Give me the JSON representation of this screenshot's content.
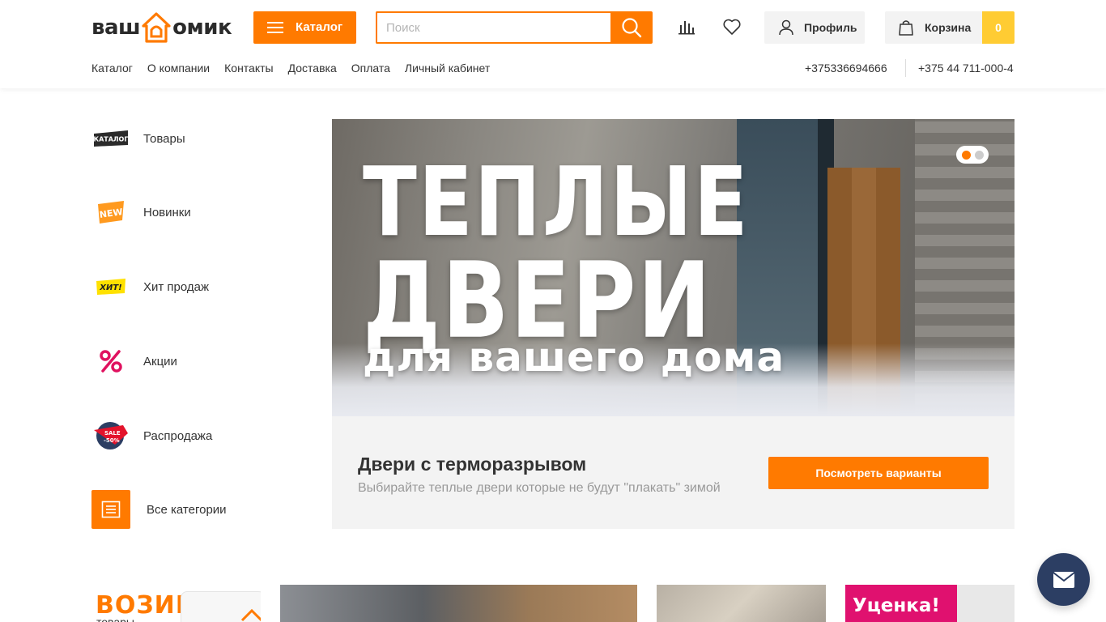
{
  "header": {
    "logo_text_left": "ваш",
    "logo_text_right": "омик",
    "catalog_label": "Каталог",
    "search": {
      "placeholder": "Поиск",
      "value": ""
    },
    "profile_label": "Профиль",
    "cart_label": "Корзина",
    "cart_count": "0"
  },
  "nav": {
    "items": [
      "Каталог",
      "О компании",
      "Контакты",
      "Доставка",
      "Оплата",
      "Личный кабинет"
    ]
  },
  "phones": [
    "+375336694666",
    "+375 44 711-000-4"
  ],
  "side_categories": [
    {
      "label": "Товары",
      "icon": "catalog-badge-icon"
    },
    {
      "label": "Новинки",
      "icon": "new-badge-icon"
    },
    {
      "label": "Хит продаж",
      "icon": "hit-badge-icon"
    },
    {
      "label": "Акции",
      "icon": "percent-icon"
    },
    {
      "label": "Распродажа",
      "icon": "sale-badge-icon"
    },
    {
      "label": "Все категории",
      "icon": "list-icon"
    }
  ],
  "badges": {
    "catalog": "КАТАЛОГ",
    "new": "NEW",
    "hit": "ХИТ!",
    "sale": "SALE",
    "sale_pct": "-50%"
  },
  "banner": {
    "line1": "ТЕПЛЫЕ",
    "line2": "ДВЕРИ",
    "line3": "для вашего дома",
    "slides": 2,
    "active_slide": 1
  },
  "promo": {
    "title": "Двери с терморазрывом",
    "description": "Выбирайте теплые двери которые не будут \"плакать\" зимой",
    "button": "Посмотреть варианты"
  },
  "cards": {
    "card1_big": "ВОЗИМ",
    "card1_small": "товары",
    "card4_tag": "Уценка!"
  },
  "colors": {
    "accent": "#ff7a00",
    "cart_badge": "#ffcc33",
    "chat": "#2c3e63"
  }
}
